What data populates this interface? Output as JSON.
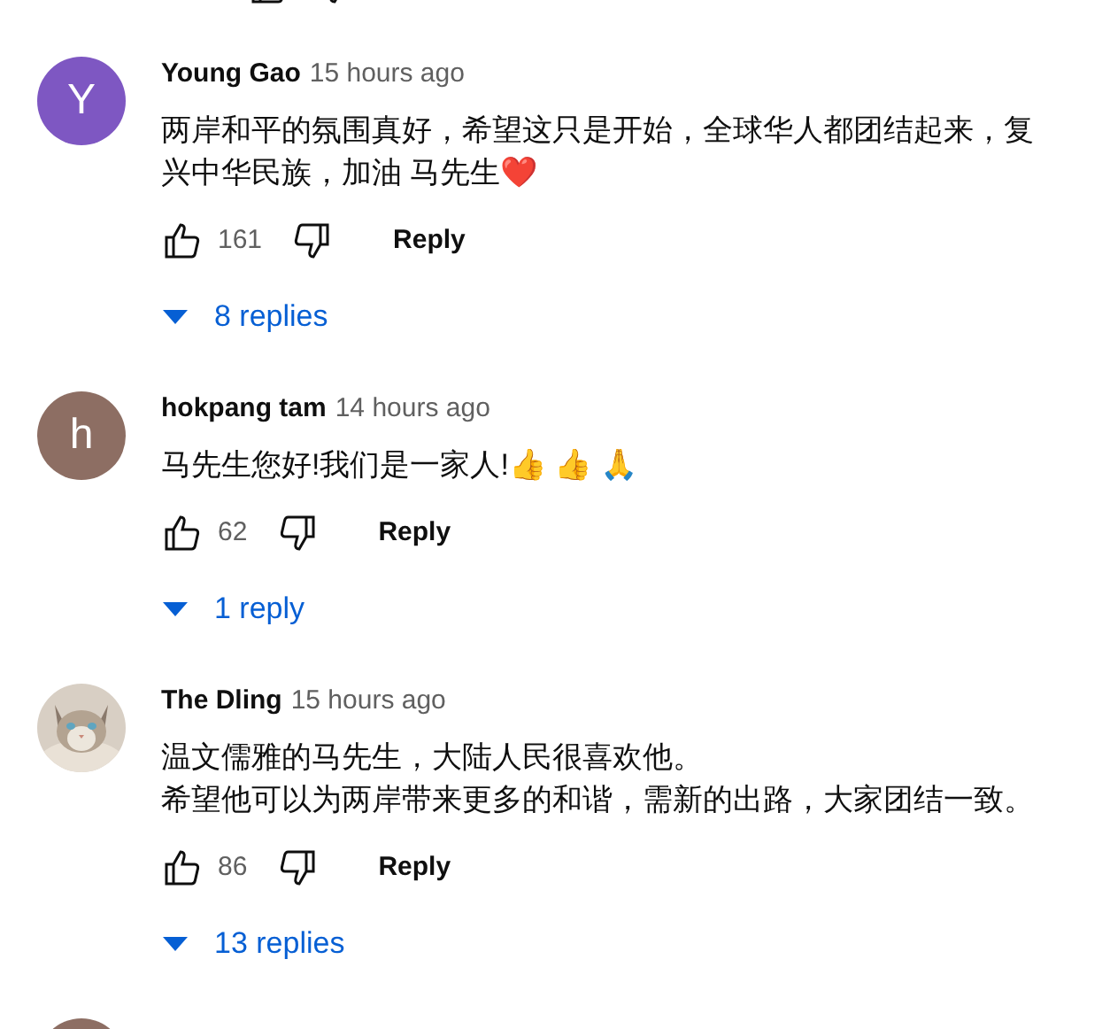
{
  "comments": [
    {
      "author": "Young Gao",
      "time": "15 hours ago",
      "avatar": {
        "kind": "letter",
        "letter": "Y",
        "color": "#7e57c2"
      },
      "lines": [
        "两岸和平的氛围真好，希望这只是开始，全球华人都团结起来，复",
        "兴中华民族，加油 马先生❤️"
      ],
      "likes": "161",
      "reply_label": "Reply",
      "replies": "8 replies"
    },
    {
      "author": "hokpang tam",
      "time": "14 hours ago",
      "avatar": {
        "kind": "letter",
        "letter": "h",
        "color": "#8d6e63"
      },
      "lines": [
        "马先生您好!我们是一家人!👍 👍 🙏"
      ],
      "likes": "62",
      "reply_label": "Reply",
      "replies": "1 reply"
    },
    {
      "author": "The Dling",
      "time": "15 hours ago",
      "lines": [
        "温文儒雅的马先生，大陆人民很喜欢他。",
        "希望他可以为两岸带来更多的和谐，需新的出路，大家团结一致。"
      ],
      "likes": "86",
      "reply_label": "Reply",
      "replies": "13 replies"
    },
    {
      "avatar": {
        "kind": "letter",
        "color": "#8d6e63"
      }
    }
  ]
}
